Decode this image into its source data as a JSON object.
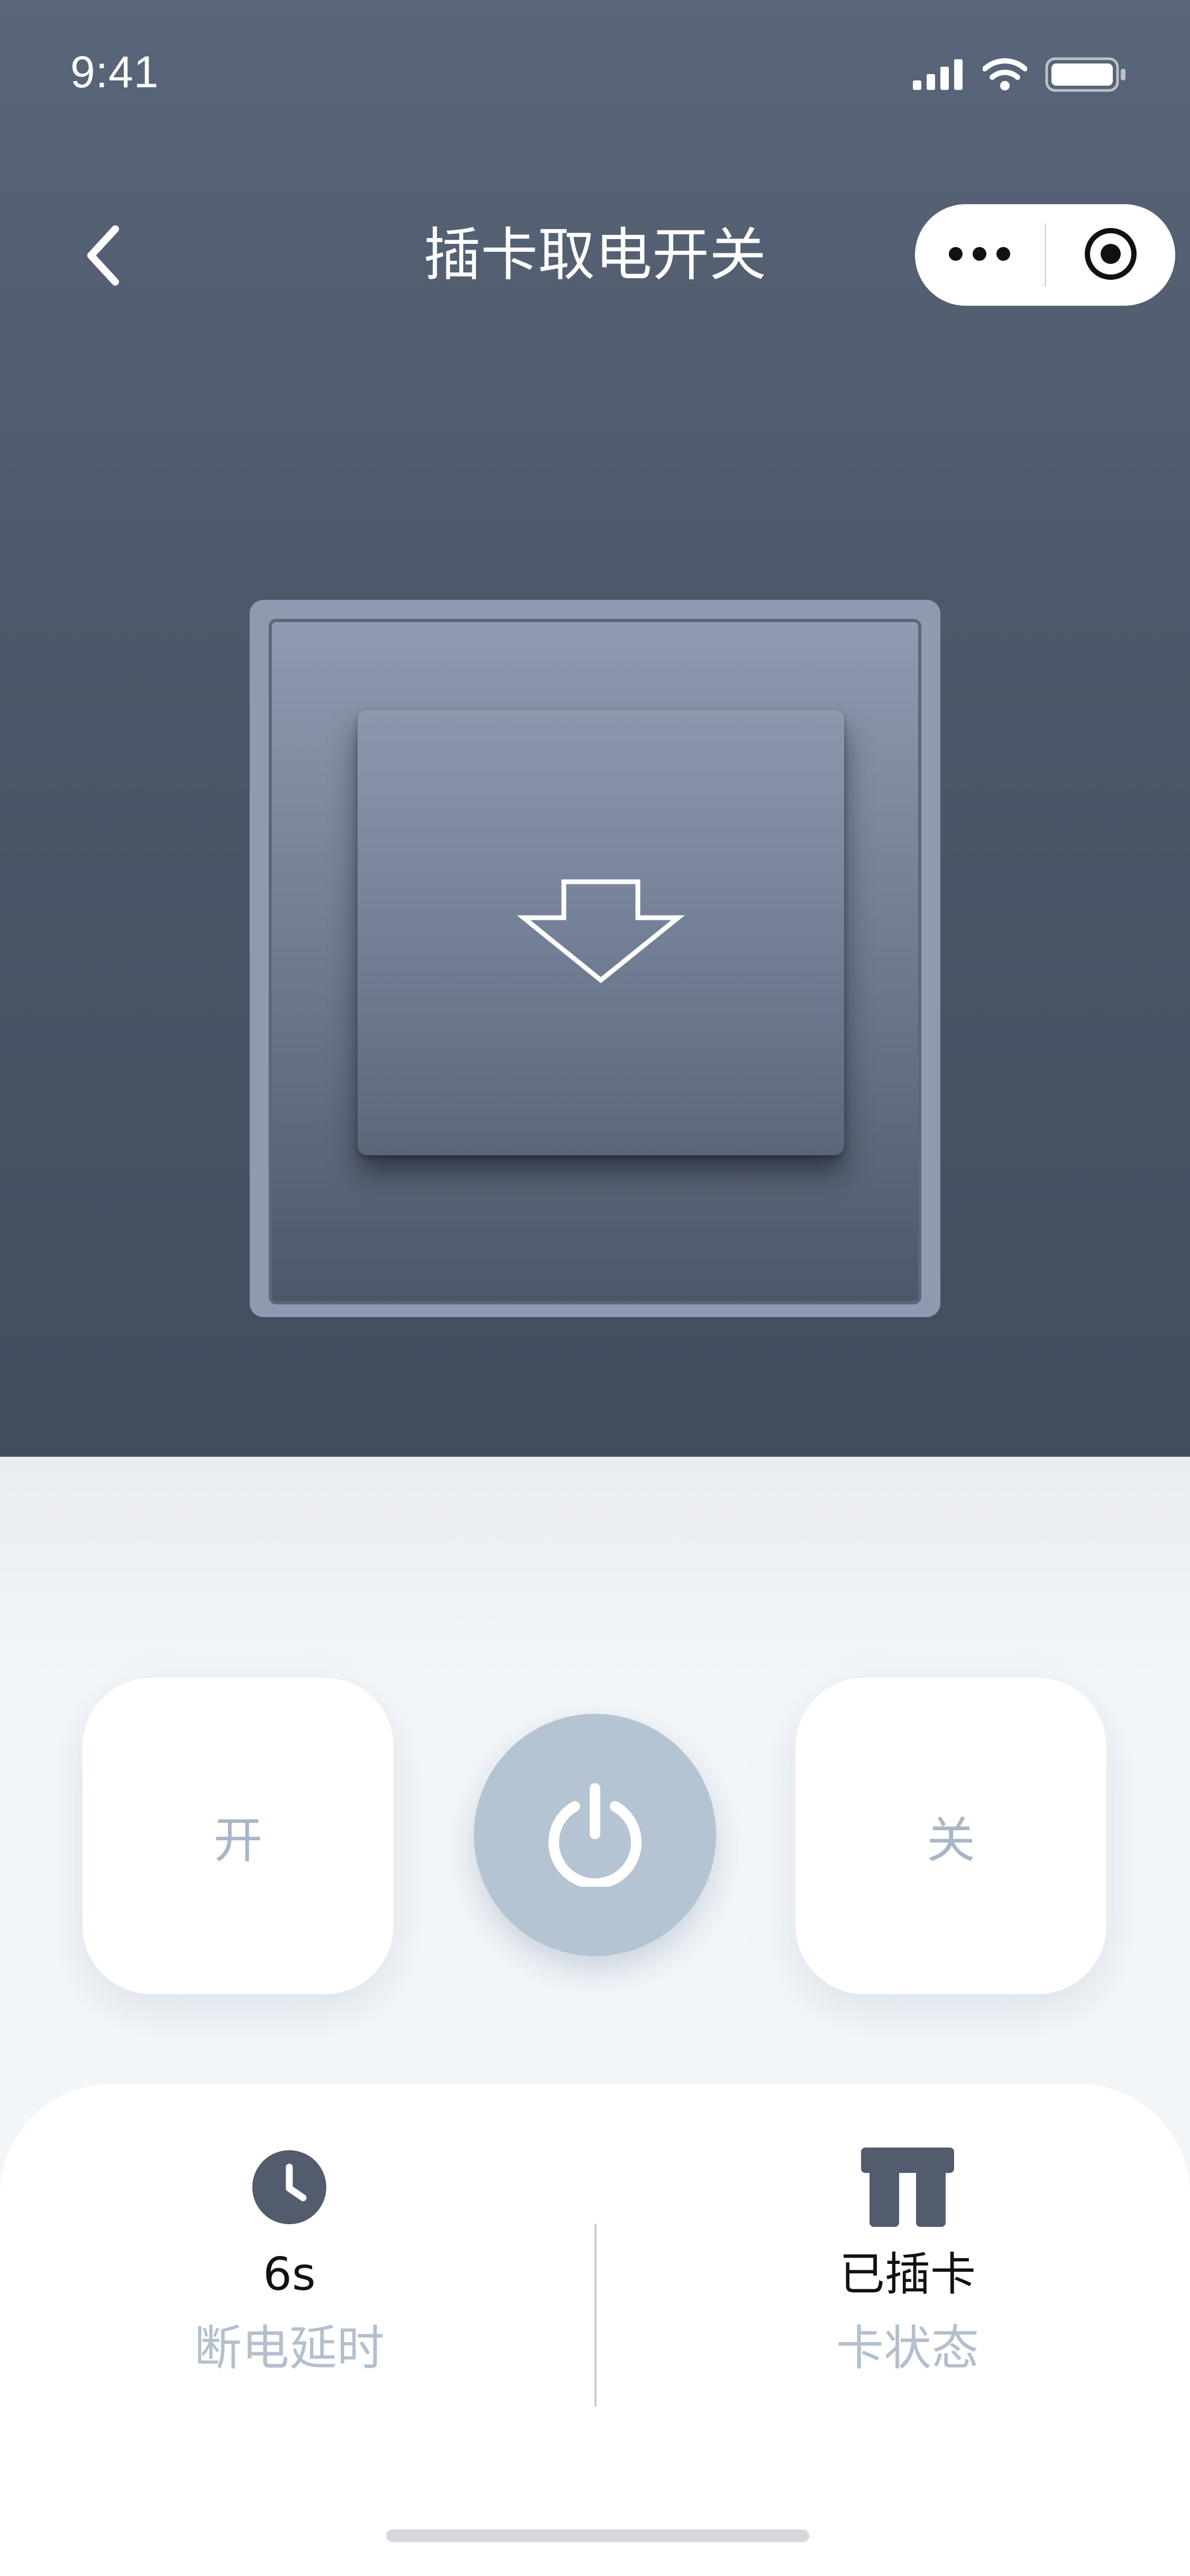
{
  "status_bar": {
    "time": "9:41",
    "icons": [
      "signal-icon",
      "wifi-icon",
      "battery-icon"
    ]
  },
  "nav": {
    "title": "插卡取电开关",
    "back_icon": "chevron-left-icon",
    "capsule": {
      "more_icon": "more-dots-icon",
      "close_icon": "target-circle-icon"
    }
  },
  "switch": {
    "icon": "arrow-down-icon"
  },
  "controls": {
    "on_label": "开",
    "off_label": "关",
    "power_icon": "power-icon"
  },
  "info": {
    "delay": {
      "icon": "clock-icon",
      "value": "6s",
      "label": "断电延时"
    },
    "card": {
      "icon": "card-icon",
      "value": "已插卡",
      "label": "卡状态"
    }
  },
  "colors": {
    "hero_top": "#596579",
    "hero_bottom": "#444d5e",
    "plate": "#8d9ab0",
    "power_button": "#b4c4d2",
    "tile_text": "#a9b6c5",
    "icon_dark": "#525c6d",
    "label_muted": "#b3bfcc"
  }
}
